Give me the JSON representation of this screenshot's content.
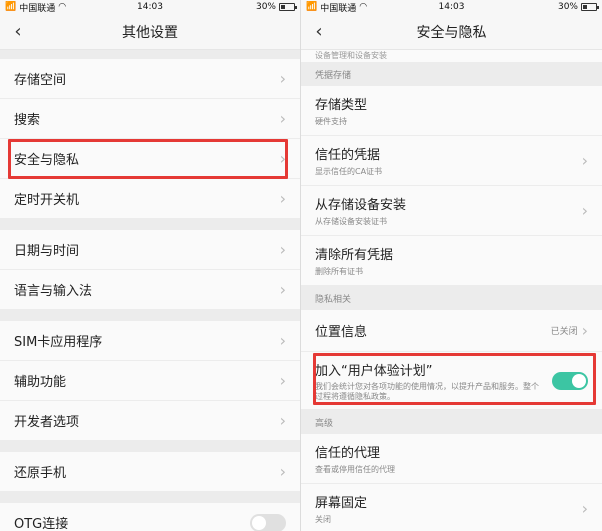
{
  "status_left": {
    "carrier": "中国联通",
    "time": "14:03",
    "battery": "30%"
  },
  "status_right": {
    "carrier": "中国联通",
    "time": "14:03",
    "battery": "30%"
  },
  "left": {
    "title": "其他设置",
    "rows": [
      "存储空间",
      "搜索",
      "安全与隐私",
      "定时开关机",
      "日期与时间",
      "语言与输入法",
      "SIM卡应用程序",
      "辅助功能",
      "开发者选项",
      "还原手机",
      "OTG连接"
    ]
  },
  "right": {
    "title": "安全与隐私",
    "partial_text": "设备管理和设备安装",
    "section_creds": "凭据存储",
    "storage_type": {
      "title": "存储类型",
      "sub": "硬件支持"
    },
    "trusted_creds": {
      "title": "信任的凭据",
      "sub": "显示信任的CA证书"
    },
    "install_storage": {
      "title": "从存储设备安装",
      "sub": "从存储设备安装证书"
    },
    "clear_creds": {
      "title": "清除所有凭据",
      "sub": "删除所有证书"
    },
    "section_privacy": "隐私相关",
    "location": {
      "title": "位置信息",
      "value": "已关闭"
    },
    "ux_plan": {
      "title": "加入“用户体验计划”",
      "desc": "我们会统计您对各项功能的使用情况，以提升产品和服务。整个过程将遵循隐私政策。"
    },
    "section_advanced": "高级",
    "trusted_agents": {
      "title": "信任的代理",
      "sub": "查看或停用信任的代理"
    },
    "screen_pin": {
      "title": "屏幕固定",
      "sub": "关闭"
    }
  },
  "colors": {
    "highlight": "#e53935",
    "toggle_on": "#3cc5a3"
  },
  "icons": {
    "back": "chevron-left-icon",
    "chevron": "chevron-right-icon",
    "signal": "signal-icon",
    "wifi": "wifi-icon",
    "battery": "battery-icon"
  }
}
